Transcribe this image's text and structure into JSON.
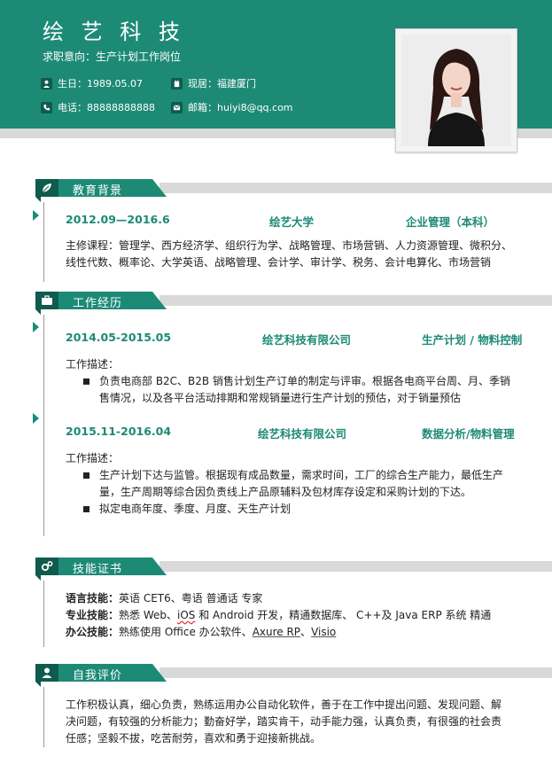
{
  "header": {
    "name": "绘 艺 科 技",
    "intent": "求职意向：生产计划工作岗位",
    "birth": "生日：1989.05.07",
    "location": "现居：福建厦门",
    "phone": "电话：88888888888",
    "email": "邮箱：huiyi8@qq.com"
  },
  "sections": {
    "education": "教育背景",
    "work": "工作经历",
    "skills": "技能证书",
    "self": "自我评价"
  },
  "education": {
    "period": "2012.09—2016.6",
    "school": "绘艺大学",
    "major": "企业管理（本科）",
    "courses_line1": "主修课程：管理学、西方经济学、组织行为学、战略管理、市场营销、人力资源管理、微积分、",
    "courses_line2": "线性代数、概率论、大学英语、战略管理、会计学、审计学、税务、会计电算化、市场营销"
  },
  "work": [
    {
      "period": "2014.05-2015.05",
      "company": "绘艺科技有限公司",
      "role": "生产计划 / 物料控制",
      "desc_label": "工作描述：",
      "b1_line1": "负责电商部 B2C、B2B 销售计划生产订单的制定与评审。根据各电商平台周、月、季销",
      "b1_line2": "售情况，以及各平台活动排期和常规销量进行生产计划的预估，对于销量预估"
    },
    {
      "period": "2015.11-2016.04",
      "company": "绘艺科技有限公司",
      "role": "数据分析/物料管理",
      "desc_label": "工作描述：",
      "b1_line1": "生产计划下达与监管。根据现有成品数量，需求时间，工厂的综合生产能力，最低生产",
      "b1_line2": "量，生产周期等综合因负责线上产品原辅料及包材库存设定和采购计划的下达。",
      "b2": "拟定电商年度、季度、月度、天生产计划"
    }
  ],
  "skills": {
    "lang_label": "语言技能：",
    "lang_text": "英语 CET6、粤语  普通话    专家",
    "pro_label": "专业技能：",
    "pro_a": "熟悉 Web、",
    "pro_ios": "iOS",
    "pro_b": " 和 Android 开发，精通数据库、  C++及 Java ERP 系统    精通",
    "office_label": "办公技能：",
    "office_a": "熟练使用 Office  办公软件、",
    "office_axure": "Axure RP",
    "office_sep": "、",
    "office_visio": "Visio"
  },
  "self": {
    "line1": "工作积极认真，细心负责，熟练运用办公自动化软件，善于在工作中提出问题、发现问题、解",
    "line2": "决问题，有较强的分析能力；勤奋好学，踏实肯干，动手能力强，认真负责，有很强的社会责",
    "line3": "任感；坚毅不拔，吃苦耐劳，喜欢和勇于迎接新挑战。"
  },
  "colors": {
    "accent": "#1d8a76",
    "accent_dark": "#0f5b4e",
    "strip": "#d9d9d9"
  }
}
